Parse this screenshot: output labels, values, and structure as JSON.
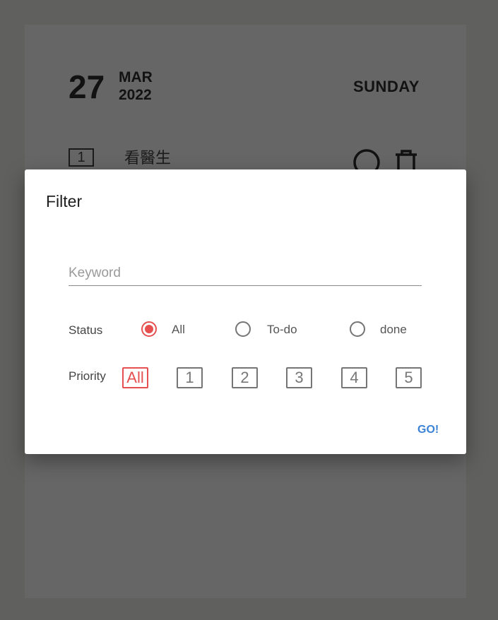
{
  "date": {
    "day": "27",
    "month": "MAR",
    "year": "2022",
    "weekday": "SUNDAY"
  },
  "task": {
    "priority": "1",
    "text": "看醫生",
    "icons": [
      "search-icon",
      "trash-icon"
    ]
  },
  "filter": {
    "title": "Filter",
    "keyword_placeholder": "Keyword",
    "keyword_value": "",
    "status_label": "Status",
    "status_options": [
      "All",
      "To-do",
      "done"
    ],
    "status_selected": "All",
    "priority_label": "Priority",
    "priority_options": [
      "All",
      "1",
      "2",
      "3",
      "4",
      "5"
    ],
    "priority_selected": "All",
    "go_label": "GO!"
  },
  "colors": {
    "backdrop": "#60605e",
    "accent": "#e65050",
    "button": "#3b82d6"
  }
}
